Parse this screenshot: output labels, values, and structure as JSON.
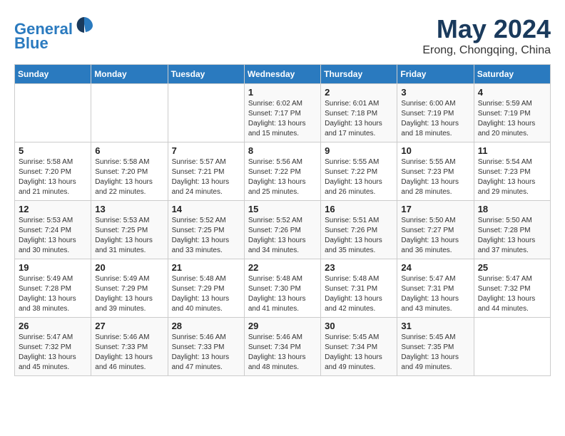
{
  "header": {
    "logo_line1": "General",
    "logo_line2": "Blue",
    "month_year": "May 2024",
    "location": "Erong, Chongqing, China"
  },
  "weekdays": [
    "Sunday",
    "Monday",
    "Tuesday",
    "Wednesday",
    "Thursday",
    "Friday",
    "Saturday"
  ],
  "weeks": [
    [
      {
        "day": "",
        "info": ""
      },
      {
        "day": "",
        "info": ""
      },
      {
        "day": "",
        "info": ""
      },
      {
        "day": "1",
        "info": "Sunrise: 6:02 AM\nSunset: 7:17 PM\nDaylight: 13 hours\nand 15 minutes."
      },
      {
        "day": "2",
        "info": "Sunrise: 6:01 AM\nSunset: 7:18 PM\nDaylight: 13 hours\nand 17 minutes."
      },
      {
        "day": "3",
        "info": "Sunrise: 6:00 AM\nSunset: 7:19 PM\nDaylight: 13 hours\nand 18 minutes."
      },
      {
        "day": "4",
        "info": "Sunrise: 5:59 AM\nSunset: 7:19 PM\nDaylight: 13 hours\nand 20 minutes."
      }
    ],
    [
      {
        "day": "5",
        "info": "Sunrise: 5:58 AM\nSunset: 7:20 PM\nDaylight: 13 hours\nand 21 minutes."
      },
      {
        "day": "6",
        "info": "Sunrise: 5:58 AM\nSunset: 7:20 PM\nDaylight: 13 hours\nand 22 minutes."
      },
      {
        "day": "7",
        "info": "Sunrise: 5:57 AM\nSunset: 7:21 PM\nDaylight: 13 hours\nand 24 minutes."
      },
      {
        "day": "8",
        "info": "Sunrise: 5:56 AM\nSunset: 7:22 PM\nDaylight: 13 hours\nand 25 minutes."
      },
      {
        "day": "9",
        "info": "Sunrise: 5:55 AM\nSunset: 7:22 PM\nDaylight: 13 hours\nand 26 minutes."
      },
      {
        "day": "10",
        "info": "Sunrise: 5:55 AM\nSunset: 7:23 PM\nDaylight: 13 hours\nand 28 minutes."
      },
      {
        "day": "11",
        "info": "Sunrise: 5:54 AM\nSunset: 7:23 PM\nDaylight: 13 hours\nand 29 minutes."
      }
    ],
    [
      {
        "day": "12",
        "info": "Sunrise: 5:53 AM\nSunset: 7:24 PM\nDaylight: 13 hours\nand 30 minutes."
      },
      {
        "day": "13",
        "info": "Sunrise: 5:53 AM\nSunset: 7:25 PM\nDaylight: 13 hours\nand 31 minutes."
      },
      {
        "day": "14",
        "info": "Sunrise: 5:52 AM\nSunset: 7:25 PM\nDaylight: 13 hours\nand 33 minutes."
      },
      {
        "day": "15",
        "info": "Sunrise: 5:52 AM\nSunset: 7:26 PM\nDaylight: 13 hours\nand 34 minutes."
      },
      {
        "day": "16",
        "info": "Sunrise: 5:51 AM\nSunset: 7:26 PM\nDaylight: 13 hours\nand 35 minutes."
      },
      {
        "day": "17",
        "info": "Sunrise: 5:50 AM\nSunset: 7:27 PM\nDaylight: 13 hours\nand 36 minutes."
      },
      {
        "day": "18",
        "info": "Sunrise: 5:50 AM\nSunset: 7:28 PM\nDaylight: 13 hours\nand 37 minutes."
      }
    ],
    [
      {
        "day": "19",
        "info": "Sunrise: 5:49 AM\nSunset: 7:28 PM\nDaylight: 13 hours\nand 38 minutes."
      },
      {
        "day": "20",
        "info": "Sunrise: 5:49 AM\nSunset: 7:29 PM\nDaylight: 13 hours\nand 39 minutes."
      },
      {
        "day": "21",
        "info": "Sunrise: 5:48 AM\nSunset: 7:29 PM\nDaylight: 13 hours\nand 40 minutes."
      },
      {
        "day": "22",
        "info": "Sunrise: 5:48 AM\nSunset: 7:30 PM\nDaylight: 13 hours\nand 41 minutes."
      },
      {
        "day": "23",
        "info": "Sunrise: 5:48 AM\nSunset: 7:31 PM\nDaylight: 13 hours\nand 42 minutes."
      },
      {
        "day": "24",
        "info": "Sunrise: 5:47 AM\nSunset: 7:31 PM\nDaylight: 13 hours\nand 43 minutes."
      },
      {
        "day": "25",
        "info": "Sunrise: 5:47 AM\nSunset: 7:32 PM\nDaylight: 13 hours\nand 44 minutes."
      }
    ],
    [
      {
        "day": "26",
        "info": "Sunrise: 5:47 AM\nSunset: 7:32 PM\nDaylight: 13 hours\nand 45 minutes."
      },
      {
        "day": "27",
        "info": "Sunrise: 5:46 AM\nSunset: 7:33 PM\nDaylight: 13 hours\nand 46 minutes."
      },
      {
        "day": "28",
        "info": "Sunrise: 5:46 AM\nSunset: 7:33 PM\nDaylight: 13 hours\nand 47 minutes."
      },
      {
        "day": "29",
        "info": "Sunrise: 5:46 AM\nSunset: 7:34 PM\nDaylight: 13 hours\nand 48 minutes."
      },
      {
        "day": "30",
        "info": "Sunrise: 5:45 AM\nSunset: 7:34 PM\nDaylight: 13 hours\nand 49 minutes."
      },
      {
        "day": "31",
        "info": "Sunrise: 5:45 AM\nSunset: 7:35 PM\nDaylight: 13 hours\nand 49 minutes."
      },
      {
        "day": "",
        "info": ""
      }
    ]
  ]
}
